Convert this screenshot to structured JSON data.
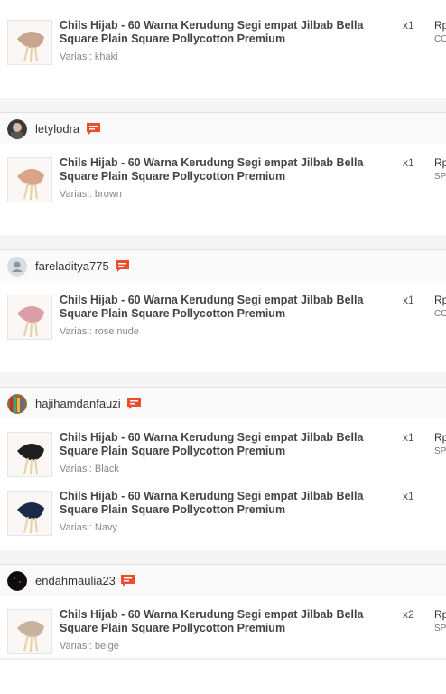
{
  "orders": [
    {
      "user": "",
      "items": [
        {
          "name": "Chils Hijab - 60 Warna Kerudung Segi empat Jilbab Bella Square Plain Square Pollycotton Premium",
          "variant": "Variasi: khaki",
          "qty": "x1",
          "price": "Rp",
          "tag": "CO",
          "color": "#c9a48e"
        }
      ]
    },
    {
      "user": "letylodra",
      "items": [
        {
          "name": "Chils Hijab - 60 Warna Kerudung Segi empat Jilbab Bella Square Plain Square Pollycotton Premium",
          "variant": "Variasi: brown",
          "qty": "x1",
          "price": "Rp",
          "tag": "SP",
          "color": "#d9a488"
        }
      ]
    },
    {
      "user": "fareladitya775",
      "items": [
        {
          "name": "Chils Hijab - 60 Warna Kerudung Segi empat Jilbab Bella Square Plain Square Pollycotton Premium",
          "variant": "Variasi: rose nude",
          "qty": "x1",
          "price": "Rp",
          "tag": "CO",
          "color": "#d99ea6"
        }
      ]
    },
    {
      "user": "hajihamdanfauzi",
      "items": [
        {
          "name": "Chils Hijab - 60 Warna Kerudung Segi empat Jilbab Bella Square Plain Square Pollycotton Premium",
          "variant": "Variasi: Black",
          "qty": "x1",
          "price": "Rp",
          "tag": "SP",
          "color": "#1f1f1f"
        },
        {
          "name": "Chils Hijab - 60 Warna Kerudung Segi empat Jilbab Bella Square Plain Square Pollycotton Premium",
          "variant": "Variasi: Navy",
          "qty": "x1",
          "price": "",
          "tag": "",
          "color": "#1c2a4a"
        }
      ]
    },
    {
      "user": "endahmaulia23",
      "items": [
        {
          "name": "Chils Hijab - 60 Warna Kerudung Segi empat Jilbab Bella Square Plain Square Pollycotton Premium",
          "variant": "Variasi: beige",
          "qty": "x2",
          "price": "Rp",
          "tag": "SP",
          "color": "#c8b3a0"
        }
      ]
    }
  ],
  "colors": {
    "accent": "#ee4d2d",
    "header_bg": "#fafafa",
    "page_bg": "#f5f5f5"
  }
}
